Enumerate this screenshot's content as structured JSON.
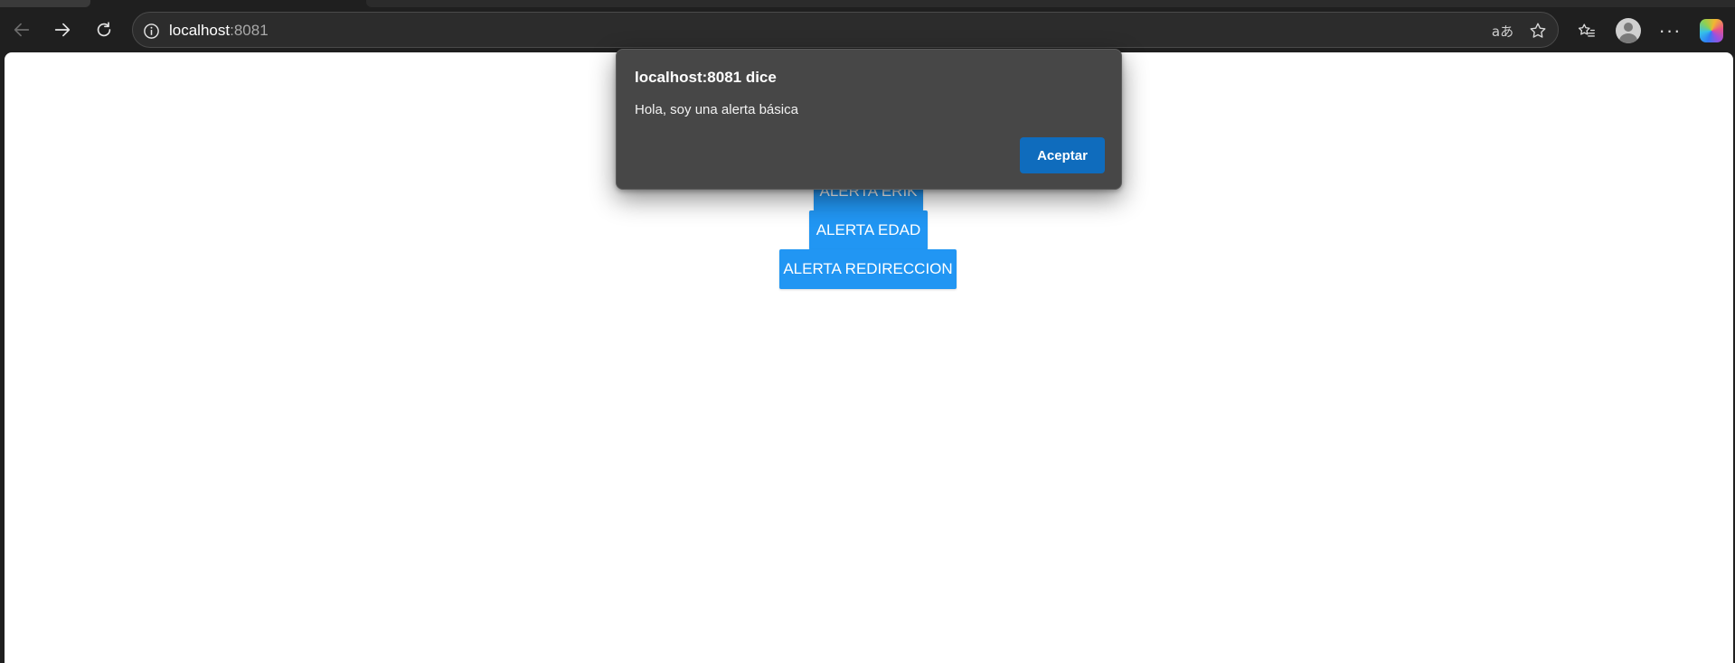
{
  "browser": {
    "address": {
      "host": "localhost",
      "port": ":8081"
    },
    "icons": {
      "back": "arrow-left-icon",
      "forward": "arrow-right-icon",
      "reload": "reload-icon",
      "site_info": "info-icon",
      "translate": "translate-icon",
      "translate_glyph": "aあ",
      "favorite": "star-icon",
      "favorites_list": "favorites-icon",
      "profile": "profile-avatar-icon",
      "more": "more-icon",
      "more_glyph": "···",
      "copilot": "copilot-icon"
    }
  },
  "page": {
    "buttons": [
      {
        "label": "ALERTA ERIK"
      },
      {
        "label": "ALERTA EDAD"
      },
      {
        "label": "ALERTA REDIRECCION"
      }
    ]
  },
  "dialog": {
    "title": "localhost:8081 dice",
    "message": "Hola, soy una alerta básica",
    "ok_label": "Aceptar"
  },
  "colors": {
    "page_button": "#2196f3",
    "dialog_background": "#474747",
    "dialog_ok_button": "#0f6cbd",
    "chrome_background": "#1f1f1f"
  }
}
